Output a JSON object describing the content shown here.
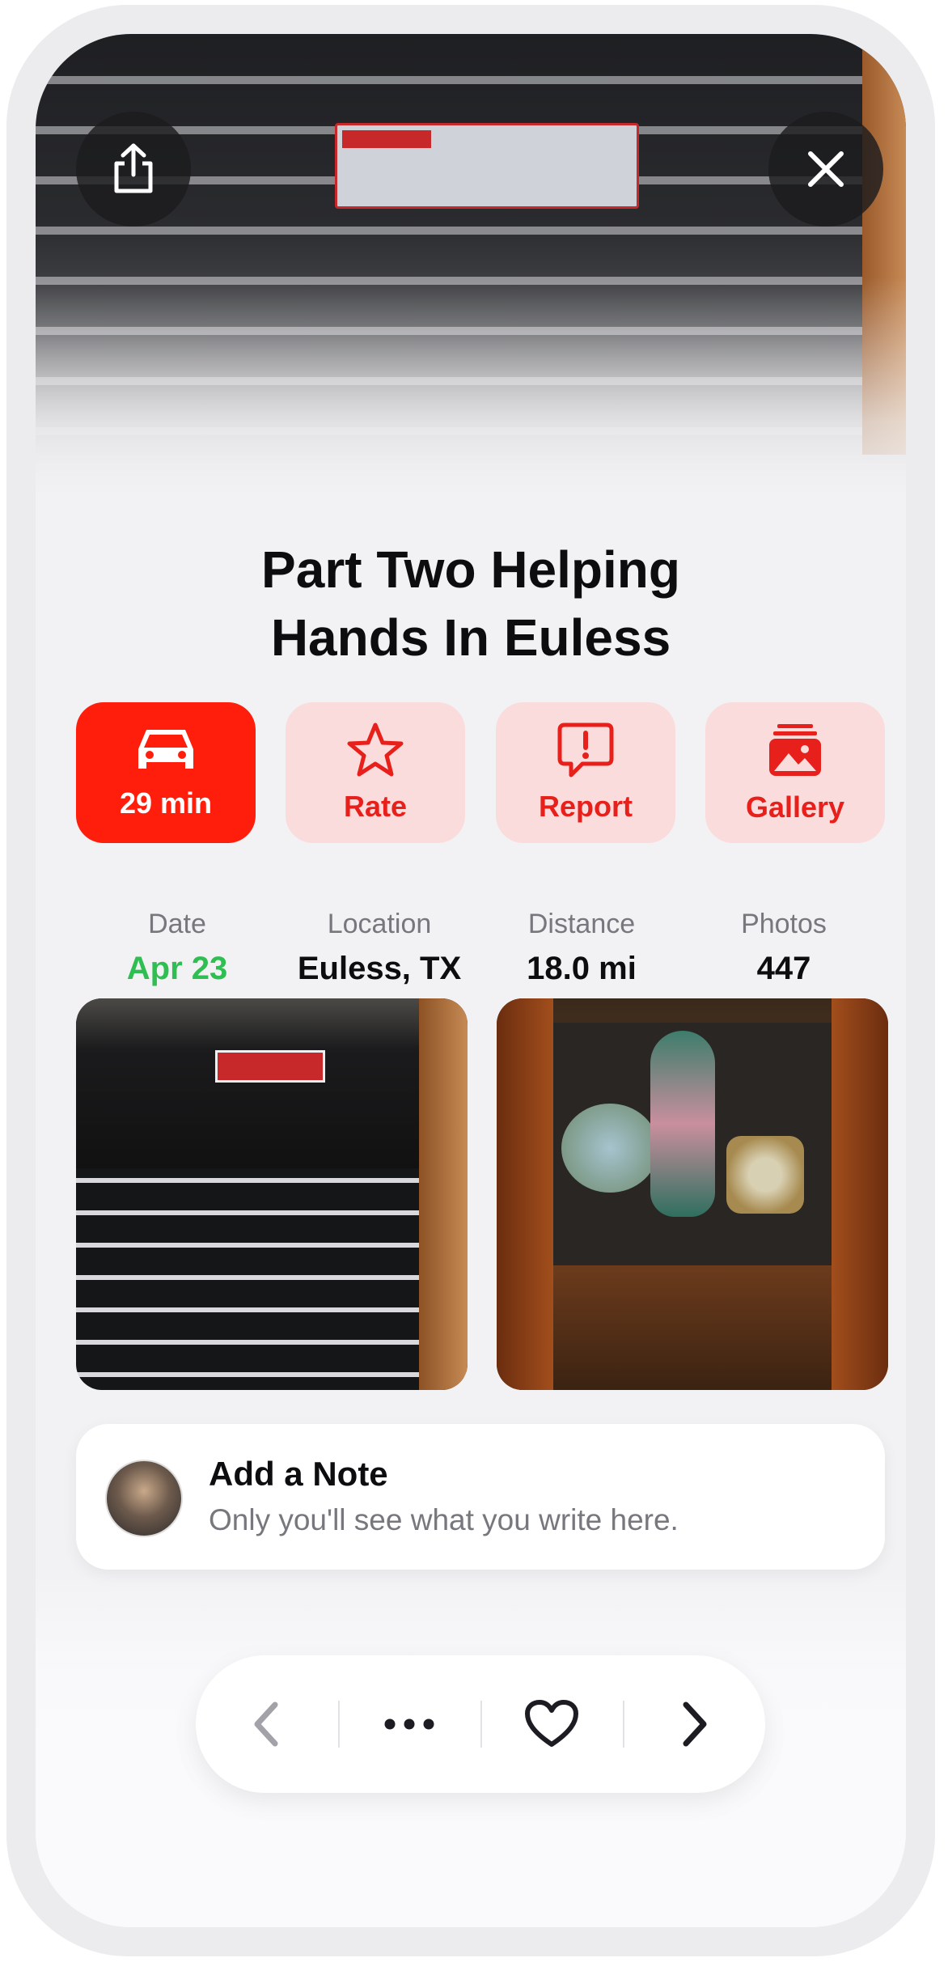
{
  "title": {
    "line1": "Part Two Helping",
    "line2": "Hands In Euless"
  },
  "actions": [
    {
      "label": "29 min",
      "icon": "car-icon"
    },
    {
      "label": "Rate",
      "icon": "star-icon"
    },
    {
      "label": "Report",
      "icon": "report-icon"
    },
    {
      "label": "Gallery",
      "icon": "gallery-icon"
    }
  ],
  "stats": {
    "date": {
      "label": "Date",
      "value": "Apr 23"
    },
    "location": {
      "label": "Location",
      "value": "Euless, TX"
    },
    "distance": {
      "label": "Distance",
      "value": "18.0 mi"
    },
    "photos": {
      "label": "Photos",
      "value": "447"
    }
  },
  "note": {
    "title": "Add a Note",
    "subtitle": "Only you'll see what you write here."
  },
  "colors": {
    "accent_red": "#ff1e0c",
    "soft_red": "#fbdcdc",
    "green": "#2fbe51"
  },
  "navbar": {
    "icons": [
      "chevron-left-icon",
      "more-icon",
      "heart-icon",
      "chevron-right-icon"
    ]
  }
}
